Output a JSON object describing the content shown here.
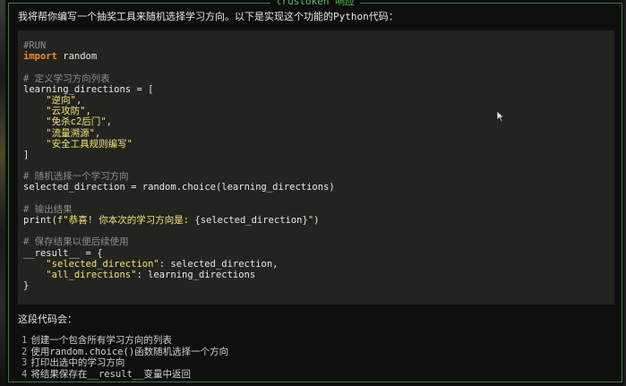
{
  "panel": {
    "title": "trustoken 响应"
  },
  "intro": "我将帮你编写一个抽奖工具来随机选择学习方向。以下是实现这个功能的Python代码：",
  "code": [
    [
      {
        "t": "#RUN",
        "c": "comment"
      }
    ],
    [
      {
        "t": "import",
        "c": "kw"
      },
      {
        "t": " random",
        "c": "plain"
      }
    ],
    [],
    [
      {
        "t": "# 定义学习方向列表",
        "c": "comment"
      }
    ],
    [
      {
        "t": "learning_directions ",
        "c": "plain"
      },
      {
        "t": "=",
        "c": "op"
      },
      {
        "t": " [",
        "c": "plain"
      }
    ],
    [
      {
        "t": "    ",
        "c": "plain"
      },
      {
        "t": "\"逆向\"",
        "c": "str"
      },
      {
        "t": ",",
        "c": "plain"
      }
    ],
    [
      {
        "t": "    ",
        "c": "plain"
      },
      {
        "t": "\"云攻防\"",
        "c": "str"
      },
      {
        "t": ",",
        "c": "plain"
      }
    ],
    [
      {
        "t": "    ",
        "c": "plain"
      },
      {
        "t": "\"免杀c2后门\"",
        "c": "str"
      },
      {
        "t": ",",
        "c": "plain"
      }
    ],
    [
      {
        "t": "    ",
        "c": "plain"
      },
      {
        "t": "\"流量溯源\"",
        "c": "str"
      },
      {
        "t": ",",
        "c": "plain"
      }
    ],
    [
      {
        "t": "    ",
        "c": "plain"
      },
      {
        "t": "\"安全工具规则编写\"",
        "c": "str"
      }
    ],
    [
      {
        "t": "]",
        "c": "plain"
      }
    ],
    [],
    [
      {
        "t": "# 随机选择一个学习方向",
        "c": "comment"
      }
    ],
    [
      {
        "t": "selected_direction ",
        "c": "plain"
      },
      {
        "t": "=",
        "c": "op"
      },
      {
        "t": " random",
        "c": "plain"
      },
      {
        "t": ".",
        "c": "op"
      },
      {
        "t": "choice(learning_directions)",
        "c": "plain"
      }
    ],
    [],
    [
      {
        "t": "# 输出结果",
        "c": "comment"
      }
    ],
    [
      {
        "t": "print(",
        "c": "plain"
      },
      {
        "t": "f\"恭喜! 你本次的学习方向是: ",
        "c": "str"
      },
      {
        "t": "{selected_direction}",
        "c": "plain"
      },
      {
        "t": "\"",
        "c": "str"
      },
      {
        "t": ")",
        "c": "plain"
      }
    ],
    [],
    [
      {
        "t": "# 保存结果以便后续使用",
        "c": "comment"
      }
    ],
    [
      {
        "t": "__result__ ",
        "c": "plain"
      },
      {
        "t": "=",
        "c": "op"
      },
      {
        "t": " {",
        "c": "plain"
      }
    ],
    [
      {
        "t": "    ",
        "c": "plain"
      },
      {
        "t": "\"selected_direction\"",
        "c": "str"
      },
      {
        "t": ": selected_direction,",
        "c": "plain"
      }
    ],
    [
      {
        "t": "    ",
        "c": "plain"
      },
      {
        "t": "\"all_directions\"",
        "c": "str"
      },
      {
        "t": ": learning_directions",
        "c": "plain"
      }
    ],
    [
      {
        "t": "}",
        "c": "plain"
      }
    ]
  ],
  "outro": "这段代码会：",
  "steps": [
    {
      "num": "1",
      "text": "创建一个包含所有学习方向的列表"
    },
    {
      "num": "2",
      "text": "使用random.choice()函数随机选择一个方向"
    },
    {
      "num": "3",
      "text": "打印出选中的学习方向"
    },
    {
      "num": "4",
      "text": "将结果保存在__result__变量中返回"
    }
  ],
  "colors": {
    "border": "#3f7a3f",
    "title": "#5fbf5f",
    "code_bg": "#23231f",
    "keyword": "#f58a2a",
    "string": "#f0e47a",
    "comment": "#8c8c8c"
  },
  "icons": {
    "cursor": "mouse-pointer-icon"
  }
}
